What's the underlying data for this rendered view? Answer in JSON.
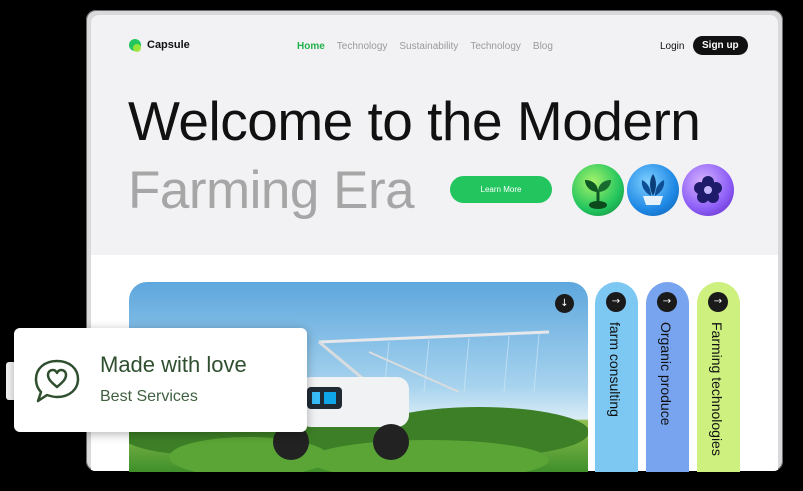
{
  "brand": {
    "name": "Capsule"
  },
  "nav": {
    "items": [
      {
        "label": "Home",
        "active": true
      },
      {
        "label": "Technology"
      },
      {
        "label": "Sustainability"
      },
      {
        "label": "Technology"
      },
      {
        "label": "Blog"
      }
    ],
    "login_label": "Login",
    "signup_label": "Sign up"
  },
  "hero": {
    "title_line1": "Welcome to the Modern",
    "title_line2": "Farming Era",
    "cta_label": "Learn More",
    "badges": [
      "sprout-icon",
      "plant-pot-icon",
      "flower-icon"
    ]
  },
  "cards": [
    {
      "label": "farm consulting",
      "color": "#7cc8f2"
    },
    {
      "label": "Organic produce",
      "color": "#78a3ee"
    },
    {
      "label": "Farming technologies",
      "color": "#cdf07e"
    }
  ],
  "love_card": {
    "title": "Made with love",
    "subtitle": "Best Services"
  },
  "colors": {
    "accent": "#22c55e",
    "dark": "#111111"
  }
}
